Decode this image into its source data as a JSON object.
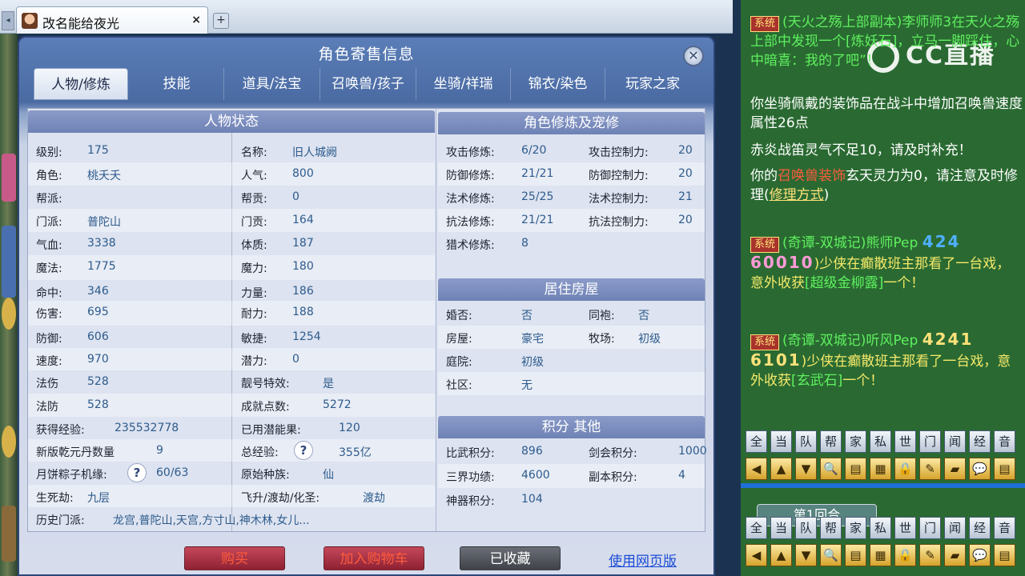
{
  "browser": {
    "tab_title": "改名能给夜光",
    "close_glyph": "×",
    "add_glyph": "+",
    "scroll_glyph": "◂"
  },
  "dialog": {
    "title": "角色寄售信息",
    "close_glyph": "✕",
    "tabs": [
      "人物/修炼",
      "技能",
      "道具/法宝",
      "召唤兽/孩子",
      "坐骑/祥瑞",
      "锦衣/染色",
      "玩家之家"
    ],
    "active_tab": 0
  },
  "status": {
    "header": "人物状态",
    "left": [
      {
        "label": "级别:",
        "value": "175"
      },
      {
        "label": "角色:",
        "value": "桃夭夭"
      },
      {
        "label": "帮派:",
        "value": ""
      },
      {
        "label": "门派:",
        "value": "普陀山"
      },
      {
        "label": "气血:",
        "value": "3338"
      },
      {
        "label": "魔法:",
        "value": "1775"
      },
      {
        "label": "命中:",
        "value": "346"
      },
      {
        "label": "伤害:",
        "value": "695"
      },
      {
        "label": "防御:",
        "value": "606"
      },
      {
        "label": "速度:",
        "value": "970"
      },
      {
        "label": "法伤",
        "value": "528"
      },
      {
        "label": "法防",
        "value": "528"
      },
      {
        "label": "获得经验:",
        "value": "235532778"
      },
      {
        "label": "新版乾元丹数量",
        "value": "9"
      },
      {
        "label": "月饼粽子机缘:",
        "value": "60/63"
      },
      {
        "label": "生死劫:",
        "value": "九层"
      },
      {
        "label": "历史门派:",
        "value": "龙宫,普陀山,天宫,方寸山,神木林,女儿..."
      }
    ],
    "right": [
      {
        "label": "名称:",
        "value": "旧人城阙"
      },
      {
        "label": "人气:",
        "value": "800"
      },
      {
        "label": "帮贡:",
        "value": "0"
      },
      {
        "label": "门贡:",
        "value": "164"
      },
      {
        "label": "体质:",
        "value": "187"
      },
      {
        "label": "魔力:",
        "value": "180"
      },
      {
        "label": "力量:",
        "value": "186"
      },
      {
        "label": "耐力:",
        "value": "188"
      },
      {
        "label": "敏捷:",
        "value": "1254"
      },
      {
        "label": "潜力:",
        "value": "0"
      },
      {
        "label": "靓号特效:",
        "value": "是"
      },
      {
        "label": "成就点数:",
        "value": "5272"
      },
      {
        "label": "已用潜能果:",
        "value": "120"
      },
      {
        "label": "总经验:",
        "value": "355亿"
      },
      {
        "label": "原始种族:",
        "value": "仙"
      },
      {
        "label": "飞升/渡劫/化圣:",
        "value": "渡劫"
      }
    ],
    "help_glyph": "?"
  },
  "cultivation": {
    "header": "角色修炼及宠修",
    "rows": [
      {
        "l1": "攻击修炼:",
        "v1": "6/20",
        "l2": "攻击控制力:",
        "v2": "20"
      },
      {
        "l1": "防御修炼:",
        "v1": "21/21",
        "l2": "防御控制力:",
        "v2": "20"
      },
      {
        "l1": "法术修炼:",
        "v1": "25/25",
        "l2": "法术控制力:",
        "v2": "21"
      },
      {
        "l1": "抗法修炼:",
        "v1": "21/21",
        "l2": "抗法控制力:",
        "v2": "20"
      },
      {
        "l1": "猎术修炼:",
        "v1": "8",
        "l2": "",
        "v2": ""
      }
    ]
  },
  "housing": {
    "header": "居住房屋",
    "rows": [
      {
        "l1": "婚否:",
        "v1": "否",
        "l2": "同袍:",
        "v2": "否"
      },
      {
        "l1": "房屋:",
        "v1": "豪宅",
        "l2": "牧场:",
        "v2": "初级"
      },
      {
        "l1": "庭院:",
        "v1": "初级",
        "l2": "",
        "v2": ""
      },
      {
        "l1": "社区:",
        "v1": "无",
        "l2": "",
        "v2": ""
      }
    ]
  },
  "points": {
    "header": "积分 其他",
    "rows": [
      {
        "l1": "比武积分:",
        "v1": "896",
        "l2": "剑会积分:",
        "v2": "1000"
      },
      {
        "l1": "三界功绩:",
        "v1": "4600",
        "l2": "副本积分:",
        "v2": "4"
      },
      {
        "l1": "神器积分:",
        "v1": "104",
        "l2": "",
        "v2": ""
      }
    ]
  },
  "actions": {
    "buy": "购买",
    "add_cart": "加入购物车",
    "favorited": "已收藏",
    "web_version": "使用网页版"
  },
  "chat": {
    "sys_tag": "系统",
    "watermark": "CC直播",
    "m1": "(天火之殇上部副本)李师师3在天火之殇上部中发现一个[炼妖石]，立马一脚踩住，心中暗喜：我的了吧”！",
    "m2": "你坐骑佩戴的装饰品在战斗中增加召唤兽速度属性26点",
    "m3": "赤炎战笛灵气不足10，请及时补充！",
    "m4a": "你的",
    "m4b": "召唤兽装饰",
    "m4c": "玄天灵力为0，请注意及时修理(",
    "m4d": "修理方式",
    "m4e": ")",
    "m5a": "(奇谭-双城记)熊师Pep",
    "m5num1": "424",
    "m5num2": "60010",
    "m5b": ")少侠在癫散班主那看了一台戏，意外收获",
    "m5c": "[超级金柳露]",
    "m5d": "一个！",
    "m6a": "(奇谭-双城记)听风Pep",
    "m6num1": "4241",
    "m6num2": "6101",
    "m6b": ")少侠在癫散班主那看了一台戏，意外收获",
    "m6c": "[玄武石]",
    "m6d": "一个！",
    "channel_buttons": [
      "全",
      "当",
      "队",
      "帮",
      "家",
      "私",
      "世",
      "门",
      "闻",
      "经",
      "音"
    ],
    "tool_icons": [
      "◀",
      "▲",
      "▼",
      "🔍",
      "▤",
      "▦",
      "🔒",
      "✎",
      "▰",
      "💬",
      "▤"
    ],
    "round_label": "第1回合"
  }
}
